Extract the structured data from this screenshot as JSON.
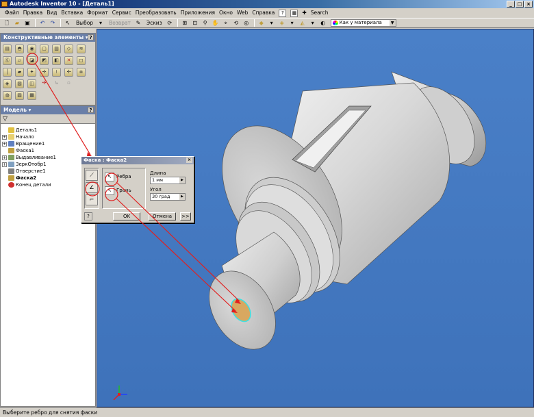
{
  "window": {
    "title": "Autodesk Inventor 10 - [Деталь1]",
    "controls": [
      "_",
      "□",
      "×"
    ]
  },
  "menubar": {
    "items": [
      "Файл",
      "Правка",
      "Вид",
      "Вставка",
      "Формат",
      "Сервис",
      "Преобразовать",
      "Приложения",
      "Окно",
      "Web",
      "Справка"
    ],
    "search_label": "Search"
  },
  "toolbar": {
    "select_label": "Выбор",
    "return_label": "Возврат",
    "sketch_label": "Эскиз",
    "material_combo": "Как у материала"
  },
  "features_panel": {
    "title": "Конструктивные элементы ▾",
    "help": "?"
  },
  "model_panel": {
    "title": "Модель ▾",
    "help": "?",
    "tree": [
      {
        "label": "Деталь1",
        "expander": "",
        "color": "#e0c040"
      },
      {
        "label": "Начало",
        "expander": "+",
        "color": "#e8d070"
      },
      {
        "label": "Вращение1",
        "expander": "+",
        "color": "#6080c0"
      },
      {
        "label": "Фаска1",
        "expander": "",
        "color": "#c0a040"
      },
      {
        "label": "Выдавливание1",
        "expander": "+",
        "color": "#80a060"
      },
      {
        "label": "ЗеркОтобр1",
        "expander": "+",
        "color": "#80a0c0"
      },
      {
        "label": "Отверстие1",
        "expander": "",
        "color": "#808080"
      },
      {
        "label": "Фаска2",
        "expander": "",
        "color": "#c0a040",
        "bold": true
      },
      {
        "label": "Конец детали",
        "expander": "",
        "color": "#d03030"
      }
    ]
  },
  "chamfer_dialog": {
    "title": "Фаска : Фаска2",
    "close": "×",
    "edges_label": "Ребра",
    "faces_label": "Грань",
    "length_label": "Длина",
    "length_value": "1 мм",
    "angle_label": "Угол",
    "angle_value": "30 град",
    "help": "?",
    "ok_label": "OK",
    "cancel_label": "Отмена",
    "more_label": ">>"
  },
  "statusbar": {
    "text": "Выберите ребро для снятия фаски"
  },
  "colors": {
    "viewport_bg": "#4a80c8",
    "annotation_red": "#e02020",
    "selected_edge": "#40e0e0"
  }
}
